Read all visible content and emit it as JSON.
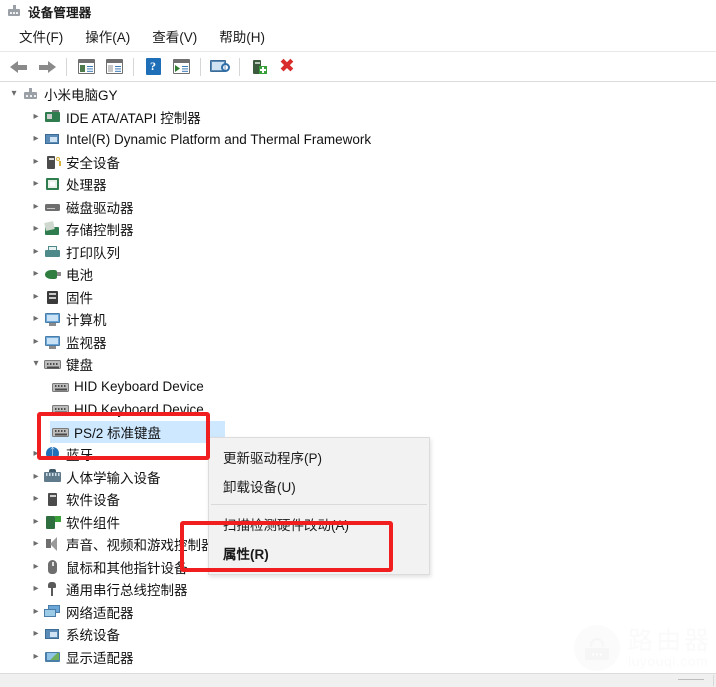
{
  "window": {
    "title": "设备管理器",
    "icon": "device-manager-icon"
  },
  "menubar": {
    "items": [
      {
        "label": "文件(F)",
        "name": "menu-file"
      },
      {
        "label": "操作(A)",
        "name": "menu-action"
      },
      {
        "label": "查看(V)",
        "name": "menu-view"
      },
      {
        "label": "帮助(H)",
        "name": "menu-help"
      }
    ]
  },
  "toolbar": {
    "buttons": [
      {
        "icon": "back-arrow-icon",
        "name": "toolbar-back"
      },
      {
        "icon": "forward-arrow-icon",
        "name": "toolbar-forward"
      },
      {
        "icon": "show-hide-console-tree-icon",
        "name": "toolbar-show-hide-tree"
      },
      {
        "icon": "properties-window-icon",
        "name": "toolbar-properties"
      },
      {
        "icon": "help-icon",
        "name": "toolbar-help"
      },
      {
        "icon": "update-driver-icon",
        "name": "toolbar-update-driver"
      },
      {
        "icon": "scan-hardware-changes-icon",
        "name": "toolbar-scan-hardware"
      },
      {
        "icon": "enable-device-icon",
        "name": "toolbar-enable-device"
      },
      {
        "icon": "uninstall-device-icon",
        "name": "toolbar-uninstall-device"
      }
    ]
  },
  "tree": {
    "root": {
      "label": "小米电脑GY",
      "expanded": true,
      "icon": "computer-root-icon"
    },
    "items": [
      {
        "label": "IDE ATA/ATAPI 控制器",
        "icon": "ide-controller-icon",
        "indent": 1,
        "state": "collapsed"
      },
      {
        "label": "Intel(R) Dynamic Platform and Thermal Framework",
        "icon": "thermal-framework-icon",
        "indent": 1,
        "state": "collapsed"
      },
      {
        "label": "安全设备",
        "icon": "security-device-icon",
        "indent": 1,
        "state": "collapsed"
      },
      {
        "label": "处理器",
        "icon": "processor-icon",
        "indent": 1,
        "state": "collapsed"
      },
      {
        "label": "磁盘驱动器",
        "icon": "disk-drive-icon",
        "indent": 1,
        "state": "collapsed"
      },
      {
        "label": "存储控制器",
        "icon": "storage-controller-icon",
        "indent": 1,
        "state": "collapsed"
      },
      {
        "label": "打印队列",
        "icon": "print-queue-icon",
        "indent": 1,
        "state": "collapsed"
      },
      {
        "label": "电池",
        "icon": "battery-icon",
        "indent": 1,
        "state": "collapsed"
      },
      {
        "label": "固件",
        "icon": "firmware-icon",
        "indent": 1,
        "state": "collapsed"
      },
      {
        "label": "计算机",
        "icon": "computer-icon",
        "indent": 1,
        "state": "collapsed"
      },
      {
        "label": "监视器",
        "icon": "monitor-icon",
        "indent": 1,
        "state": "collapsed"
      },
      {
        "label": "键盘",
        "icon": "keyboard-icon",
        "indent": 1,
        "state": "expanded"
      },
      {
        "label": "HID Keyboard Device",
        "icon": "keyboard-device-icon",
        "indent": 2,
        "state": "leaf"
      },
      {
        "label": "HID Keyboard Device",
        "icon": "keyboard-device-icon",
        "indent": 2,
        "state": "leaf"
      },
      {
        "label": "PS/2 标准键盘",
        "icon": "keyboard-device-icon",
        "indent": 2,
        "state": "leaf",
        "selected": true
      },
      {
        "label": "蓝牙",
        "icon": "bluetooth-icon",
        "indent": 1,
        "state": "collapsed"
      },
      {
        "label": "人体学输入设备",
        "icon": "human-interface-device-icon",
        "indent": 1,
        "state": "collapsed"
      },
      {
        "label": "软件设备",
        "icon": "software-device-icon",
        "indent": 1,
        "state": "collapsed"
      },
      {
        "label": "软件组件",
        "icon": "software-component-icon",
        "indent": 1,
        "state": "collapsed"
      },
      {
        "label": "声音、视频和游戏控制器",
        "icon": "sound-video-game-icon",
        "indent": 1,
        "state": "collapsed"
      },
      {
        "label": "鼠标和其他指针设备",
        "icon": "mouse-icon",
        "indent": 1,
        "state": "collapsed"
      },
      {
        "label": "通用串行总线控制器",
        "icon": "usb-controller-icon",
        "indent": 1,
        "state": "collapsed"
      },
      {
        "label": "网络适配器",
        "icon": "network-adapter-icon",
        "indent": 1,
        "state": "collapsed"
      },
      {
        "label": "系统设备",
        "icon": "system-device-icon",
        "indent": 1,
        "state": "collapsed"
      },
      {
        "label": "显示适配器",
        "icon": "display-adapter-icon",
        "indent": 1,
        "state": "collapsed"
      }
    ]
  },
  "context_menu": {
    "items": [
      {
        "label": "更新驱动程序(P)",
        "name": "ctx-update-driver",
        "bold": false
      },
      {
        "label": "卸载设备(U)",
        "name": "ctx-uninstall-device",
        "bold": false
      },
      {
        "label": "扫描检测硬件改动(A)",
        "name": "ctx-scan-hardware-changes",
        "bold": false
      },
      {
        "label": "属性(R)",
        "name": "ctx-properties",
        "bold": true
      }
    ]
  },
  "annotations": [
    {
      "name": "redbox-keyboard",
      "target": "PS/2 标准键盘",
      "color": "#f01e1e"
    },
    {
      "name": "redbox-properties",
      "target": "属性(R)",
      "color": "#f01e1e"
    }
  ],
  "watermark": {
    "cn": "路由器",
    "en": "luyouqi.com",
    "icon": "router-icon"
  },
  "colors": {
    "selection": "#cde8ff",
    "annotation": "#f01e1e",
    "menu_bg": "#f2f2f2",
    "help_blue": "#1f6fb8",
    "close_red": "#d92b2b"
  }
}
